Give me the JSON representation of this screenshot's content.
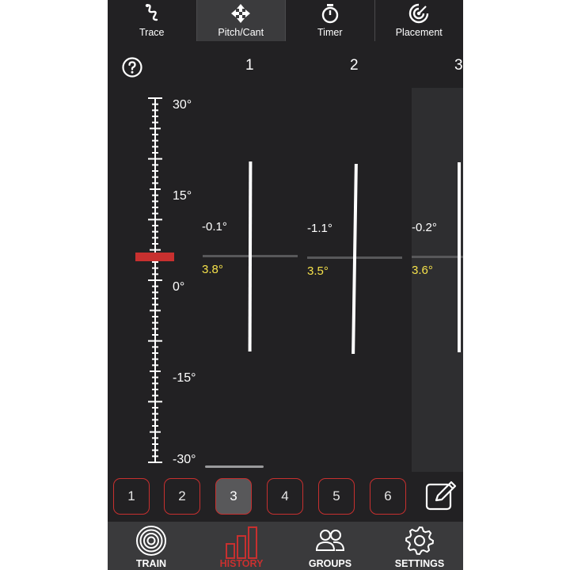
{
  "top_tabs": [
    {
      "label": "Trace",
      "icon": "trace-icon"
    },
    {
      "label": "Pitch/Cant",
      "icon": "move-arrows-icon",
      "active": true
    },
    {
      "label": "Timer",
      "icon": "stopwatch-icon"
    },
    {
      "label": "Placement",
      "icon": "placement-icon"
    }
  ],
  "columns": [
    {
      "header": "1",
      "pitch": "-0.1°",
      "cant": "3.8°"
    },
    {
      "header": "2",
      "pitch": "-1.1°",
      "cant": "3.5°"
    },
    {
      "header": "3",
      "pitch": "-0.2°",
      "cant": "3.6°"
    }
  ],
  "scale": {
    "top": "30°",
    "upper": "15°",
    "middle": "0°",
    "lower": "-15°",
    "bottom": "-30°",
    "marker_value_deg": 3.8
  },
  "shot_buttons": [
    "1",
    "2",
    "3",
    "4",
    "5",
    "6"
  ],
  "selected_shot": "3",
  "bottom_nav": [
    {
      "label": "TRAIN",
      "icon": "target-icon"
    },
    {
      "label": "HISTORY",
      "icon": "bar-chart-icon",
      "active": true
    },
    {
      "label": "GROUPS",
      "icon": "people-icon"
    },
    {
      "label": "SETTINGS",
      "icon": "gear-icon"
    }
  ],
  "colors": {
    "accent": "#c8302f",
    "cant": "#f5e14a",
    "background": "#222123"
  }
}
